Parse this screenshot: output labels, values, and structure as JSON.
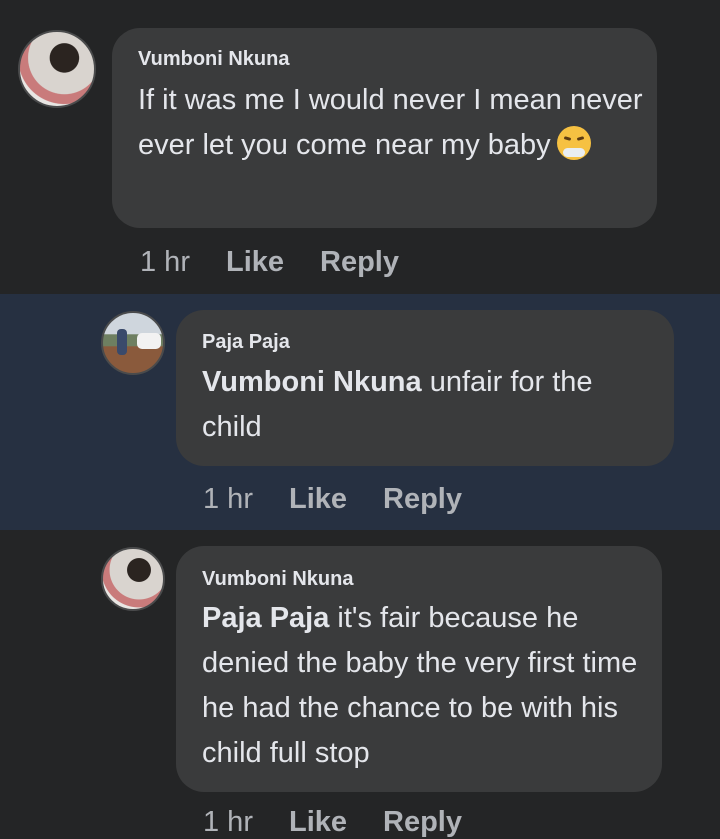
{
  "comments": [
    {
      "author": "Vumboni Nkuna",
      "mention": "",
      "text": "If it was me I would never I mean never ever let you come near my baby",
      "emoji": "steam-from-nose-emoji",
      "time": "1 hr",
      "like_label": "Like",
      "reply_label": "Reply"
    },
    {
      "author": "Paja Paja",
      "mention": "Vumboni Nkuna",
      "text": " unfair for the child",
      "time": "1 hr",
      "like_label": "Like",
      "reply_label": "Reply"
    },
    {
      "author": "Vumboni Nkuna",
      "mention": "Paja Paja",
      "text": " it's fair because he denied the baby the very first time he had the chance to be with his child full stop",
      "time": "1 hr",
      "like_label": "Like",
      "reply_label": "Reply"
    }
  ],
  "colors": {
    "background": "#242526",
    "highlight": "#263041",
    "bubble": "#3a3b3c",
    "text": "#e4e6eb",
    "secondary_text": "#b0b3b8"
  }
}
